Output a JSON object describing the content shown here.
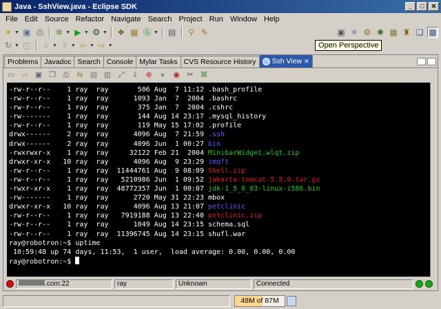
{
  "window": {
    "title": "Java - SshView.java - Eclipse SDK",
    "controls": [
      "_",
      "□",
      "✕"
    ]
  },
  "menu": [
    "File",
    "Edit",
    "Source",
    "Refactor",
    "Navigate",
    "Search",
    "Project",
    "Run",
    "Window",
    "Help"
  ],
  "tooltip": "Open Perspective",
  "tabs": [
    {
      "label": "Problems"
    },
    {
      "label": "Javadoc"
    },
    {
      "label": "Search"
    },
    {
      "label": "Console"
    },
    {
      "label": "Mylar Tasks"
    },
    {
      "label": "CVS Resource History"
    },
    {
      "label": "Ssh View",
      "close": "✕"
    }
  ],
  "terminal": {
    "lines": [
      {
        "pre": "-rw-r--r--    1 ray  ray       506 Aug  7 11:12 ",
        "name": ".bash_profile",
        "color": "plain"
      },
      {
        "pre": "-rw-r--r--    1 ray  ray      1093 Jan  7  2004 ",
        "name": ".bashrc",
        "color": "plain"
      },
      {
        "pre": "-rw-r--r--    1 ray  ray       375 Jan  7  2004 ",
        "name": ".cshrc",
        "color": "plain"
      },
      {
        "pre": "-rw-------    1 ray  ray       144 Aug 14 23:17 ",
        "name": ".mysql_history",
        "color": "plain"
      },
      {
        "pre": "-rw-r--r--    1 ray  ray       119 May 15 17:02 ",
        "name": ".profile",
        "color": "plain"
      },
      {
        "pre": "drwx------    2 ray  ray      4096 Aug  7 21:59 ",
        "name": ".ssh",
        "color": "blue"
      },
      {
        "pre": "drwx------    2 ray  ray      4096 Jun  1 00:27 ",
        "name": "bin",
        "color": "blue"
      },
      {
        "pre": "-rwxrwxr-x    1 ray  ray     32122 Feb 21  2004 ",
        "name": "MinibarWidget.wlqt.zip",
        "color": "green"
      },
      {
        "pre": "drwxr-xr-x   10 ray  ray      4096 Aug  9 23:29 ",
        "name": "imqft",
        "color": "blue"
      },
      {
        "pre": "-rw-r--r--    1 ray  ray  11444761 Aug  9 08:09 ",
        "name": "Shell.zip",
        "color": "red"
      },
      {
        "pre": "-rw-r--r--    1 ray  ray   5210986 Jun  1 09:52 ",
        "name": "jakarta-tomcat-5.5.9.tar.gz",
        "color": "red"
      },
      {
        "pre": "-rwxr-xr-x    1 ray  ray  48772357 Jun  1 00:07 ",
        "name": "jdk-1_5_0_03-linux-i586.bin",
        "color": "green"
      },
      {
        "pre": "-rw-------    1 ray  ray      2720 May 31 22:23 ",
        "name": "mbox",
        "color": "plain"
      },
      {
        "pre": "drwxr-xr-x   10 ray  ray      4096 Aug 13 21:07 ",
        "name": "petclinic",
        "color": "blue"
      },
      {
        "pre": "-rw-r--r--    1 ray  ray   7919188 Aug 13 22:40 ",
        "name": "petclinic.zip",
        "color": "red"
      },
      {
        "pre": "-rw-r--r--    1 ray  ray      1049 Aug 14 23:15 ",
        "name": "schema.sql",
        "color": "plain"
      },
      {
        "pre": "-rw-r--r--    1 ray  ray  11396745 Aug 14 23:15 ",
        "name": "shufl.war",
        "color": "plain"
      },
      {
        "pre": "ray@robotron:~$ uptime",
        "name": "",
        "color": "plain"
      },
      {
        "pre": " 10:59:48 up 74 days, 11:53,  1 user,  load average: 0.00, 0.00, 0.00",
        "name": "",
        "color": "plain"
      }
    ],
    "prompt": "ray@robotron:~$ "
  },
  "view_status": {
    "host": ".com:22",
    "user": "ray",
    "state": "Unknown",
    "connection": "Connected"
  },
  "heap": {
    "used": "48M",
    "of_total": " of 87M",
    "fraction_used": 0.55
  }
}
